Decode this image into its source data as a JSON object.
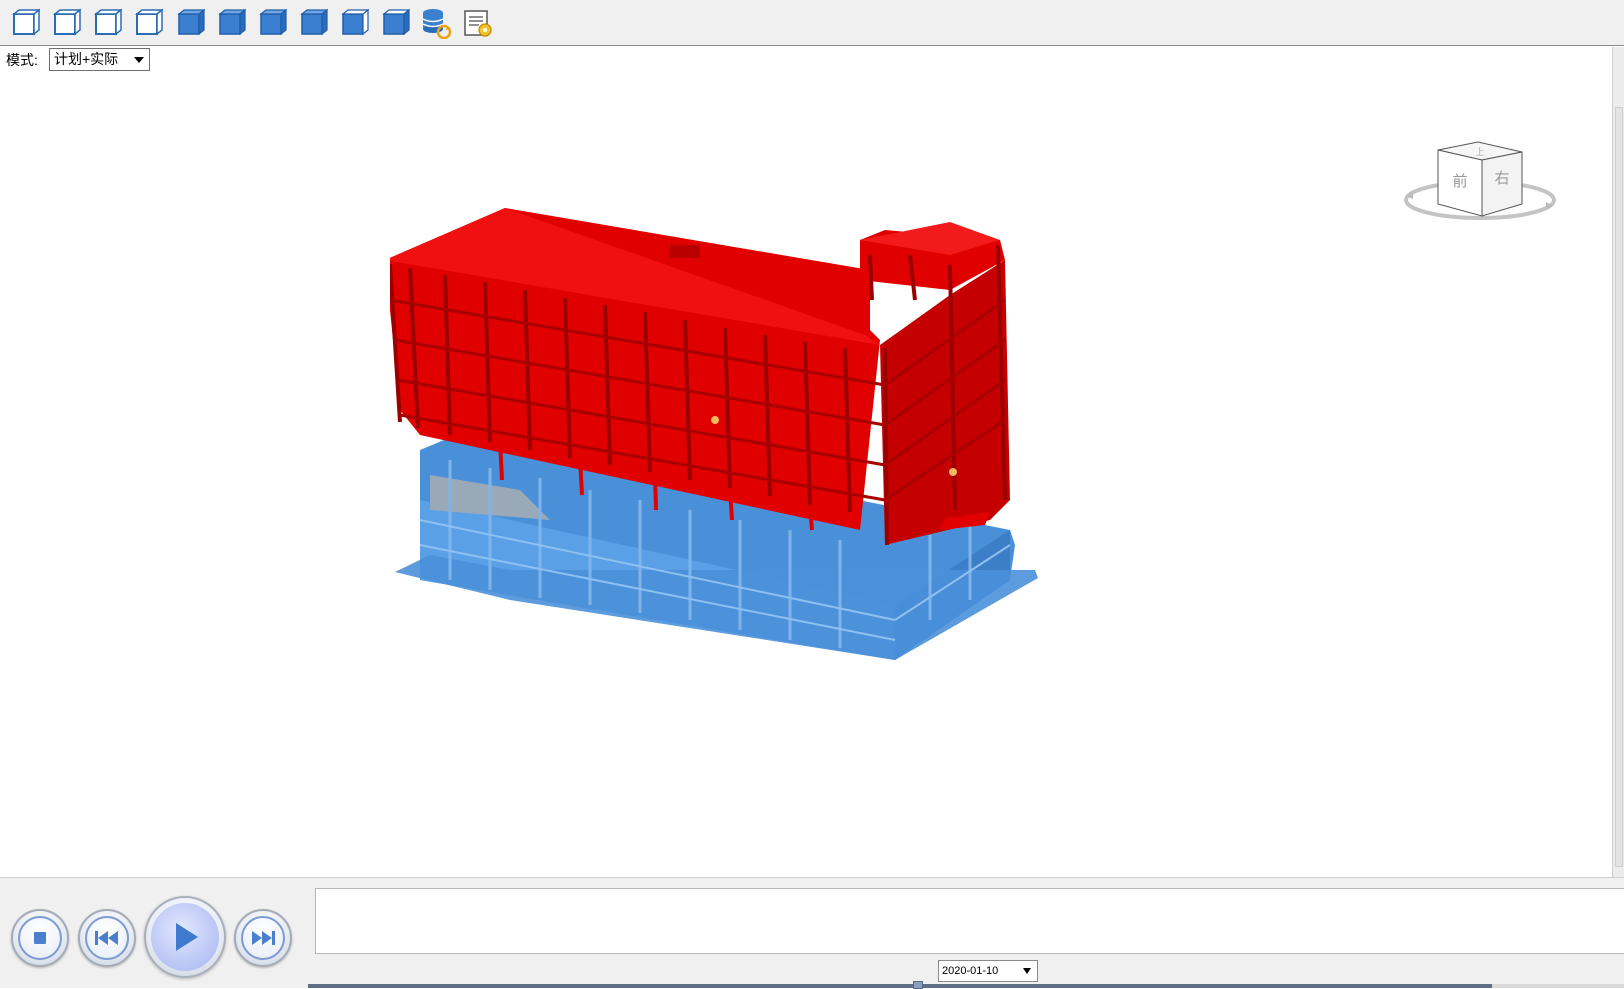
{
  "toolbar": {
    "buttons": [
      {
        "icon": "view-top-outline-icon"
      },
      {
        "icon": "view-front-outline-icon"
      },
      {
        "icon": "view-left-outline-icon"
      },
      {
        "icon": "view-right-outline-icon"
      },
      {
        "icon": "view-iso-1-icon"
      },
      {
        "icon": "view-iso-2-icon"
      },
      {
        "icon": "view-iso-3-icon"
      },
      {
        "icon": "view-iso-4-icon"
      },
      {
        "icon": "view-iso-5-icon"
      },
      {
        "icon": "view-iso-6-icon"
      },
      {
        "icon": "database-refresh-icon"
      },
      {
        "icon": "report-settings-icon"
      }
    ]
  },
  "mode": {
    "label": "模式:",
    "selected": "计划+实际"
  },
  "navcube": {
    "face_front": "前",
    "face_right": "右",
    "face_top": "上"
  },
  "colors": {
    "actual": "#e00000",
    "plan": "#4a90d9",
    "accent": "#7b9bd1"
  },
  "playback": {
    "date": "2020-01-10",
    "progress": 0.9
  }
}
